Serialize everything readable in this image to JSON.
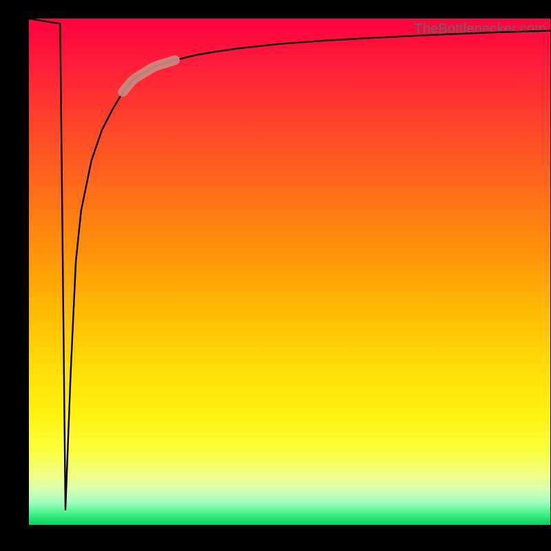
{
  "attribution": "TheBottlenecker.com",
  "colors": {
    "frame": "#000000",
    "curve": "#000000",
    "marker": "#c98a80"
  },
  "chart_data": {
    "type": "line",
    "title": "",
    "xlabel": "",
    "ylabel": "",
    "xlim": [
      0,
      100
    ],
    "ylim": [
      0,
      100
    ],
    "x": [
      0,
      6,
      7,
      8,
      9,
      10,
      12,
      14,
      16,
      18,
      20,
      24,
      28,
      32,
      36,
      40,
      48,
      56,
      64,
      72,
      80,
      90,
      100
    ],
    "values": [
      100,
      99,
      3,
      30,
      52,
      62,
      72,
      78,
      82,
      85.5,
      88,
      90.5,
      91.8,
      92.8,
      93.5,
      94.1,
      95,
      95.6,
      96.1,
      96.5,
      96.9,
      97.3,
      97.6
    ],
    "annotations": [
      {
        "kind": "highlight-segment",
        "x_from": 18,
        "x_to": 28,
        "label": "marker"
      }
    ]
  }
}
